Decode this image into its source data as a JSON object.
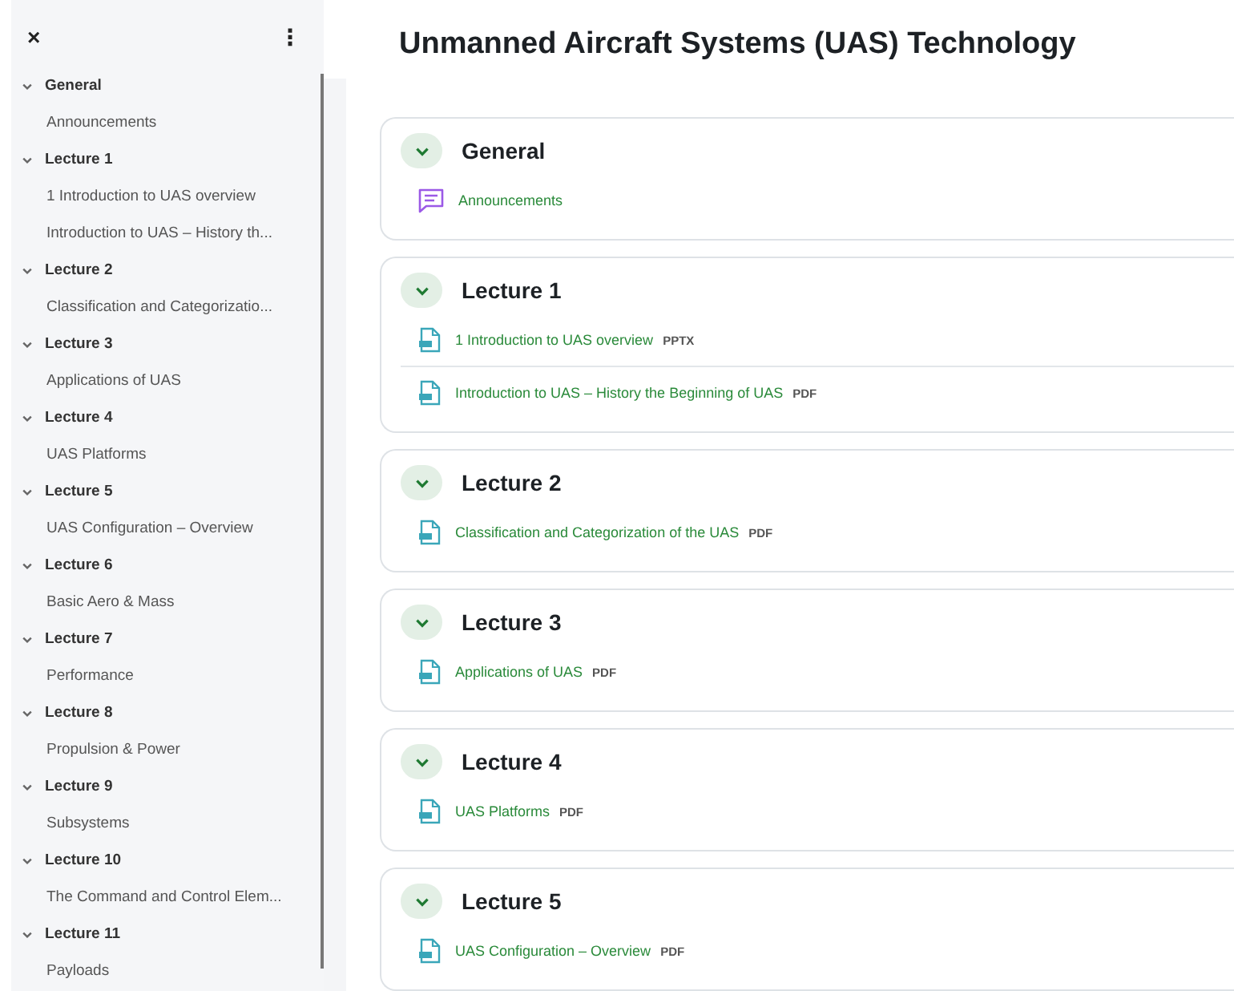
{
  "sidebar": {
    "close_icon": "×",
    "menu_icon": "⋮",
    "sections": [
      {
        "title": "General",
        "expanded": true,
        "items": [
          "Announcements"
        ]
      },
      {
        "title": "Lecture 1",
        "expanded": true,
        "items": [
          "1 Introduction to UAS overview",
          "Introduction to UAS – History th..."
        ]
      },
      {
        "title": "Lecture 2",
        "expanded": true,
        "items": [
          "Classification and Categorizatio..."
        ]
      },
      {
        "title": "Lecture 3",
        "expanded": true,
        "items": [
          "Applications of UAS"
        ]
      },
      {
        "title": "Lecture 4",
        "expanded": true,
        "items": [
          "UAS Platforms"
        ]
      },
      {
        "title": "Lecture 5",
        "expanded": true,
        "items": [
          "UAS Configuration – Overview"
        ]
      },
      {
        "title": "Lecture 6",
        "expanded": true,
        "items": [
          "Basic Aero & Mass"
        ]
      },
      {
        "title": "Lecture 7",
        "expanded": true,
        "items": [
          "Performance"
        ]
      },
      {
        "title": "Lecture 8",
        "expanded": true,
        "items": [
          "Propulsion & Power"
        ]
      },
      {
        "title": "Lecture 9",
        "expanded": true,
        "items": [
          "Subsystems"
        ]
      },
      {
        "title": "Lecture 10",
        "expanded": true,
        "items": [
          "The Command and Control Elem..."
        ]
      },
      {
        "title": "Lecture 11",
        "expanded": true,
        "items": [
          "Payloads"
        ]
      }
    ]
  },
  "course_title": "Unmanned Aircraft Systems (UAS) Technology",
  "sections": [
    {
      "title": "General",
      "expanded": true,
      "activities": [
        {
          "kind": "forum",
          "name": "Announcements"
        }
      ]
    },
    {
      "title": "Lecture 1",
      "expanded": true,
      "activities": [
        {
          "kind": "pptx",
          "name": "1 Introduction to UAS overview",
          "type": "PPTX"
        },
        {
          "kind": "pdf",
          "name": "Introduction to UAS – History the Beginning of UAS",
          "type": "PDF"
        }
      ]
    },
    {
      "title": "Lecture 2",
      "expanded": true,
      "activities": [
        {
          "kind": "pdf",
          "name": "Classification and Categorization of the UAS",
          "type": "PDF"
        }
      ]
    },
    {
      "title": "Lecture 3",
      "expanded": true,
      "activities": [
        {
          "kind": "pdf",
          "name": "Applications of UAS",
          "type": "PDF"
        }
      ]
    },
    {
      "title": "Lecture 4",
      "expanded": true,
      "activities": [
        {
          "kind": "pdf",
          "name": "UAS Platforms",
          "type": "PDF"
        }
      ]
    },
    {
      "title": "Lecture 5",
      "expanded": true,
      "activities": [
        {
          "kind": "pdf",
          "name": "UAS Configuration – Overview",
          "type": "PDF"
        }
      ]
    }
  ]
}
